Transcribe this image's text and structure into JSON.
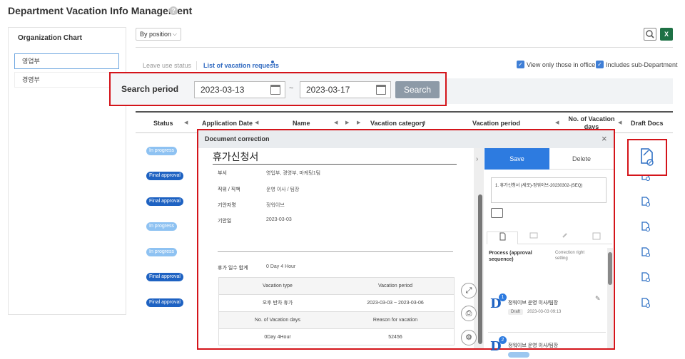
{
  "page_title": "Department Vacation Info Management",
  "help_icon": "?",
  "org_chart": {
    "title": "Organization Chart",
    "items": [
      "영업부",
      "경영부"
    ]
  },
  "toolbar": {
    "view_select": "By position",
    "excel_label": "X"
  },
  "tabs": {
    "leave_status": "Leave use status",
    "requests": "List of vacation requests"
  },
  "filters": {
    "view_office": "View only those in office",
    "include_sub": "Includes sub-Department"
  },
  "search": {
    "label": "Search period",
    "start": "2023-03-13",
    "separator": "~",
    "end": "2023-03-17",
    "button": "Search"
  },
  "table": {
    "headers": [
      "Status",
      "Application Date",
      "Name",
      "Vacation category",
      "Vacation period",
      "No. of Vacation days",
      "Draft Docs"
    ],
    "rows": [
      {
        "status": "In progress",
        "kind": "in-progress"
      },
      {
        "status": "Final approval",
        "kind": "final"
      },
      {
        "status": "Final approval",
        "kind": "final"
      },
      {
        "status": "In progress",
        "kind": "in-progress"
      },
      {
        "status": "In progress",
        "kind": "in-progress"
      },
      {
        "status": "Final approval",
        "kind": "final"
      },
      {
        "status": "Final approval",
        "kind": "final"
      }
    ]
  },
  "modal": {
    "title": "Document correction",
    "close": "×",
    "doc": {
      "title": "휴가신청서",
      "fields": [
        {
          "k": "부서",
          "v": "영업부, 경영부, 마케팅1팀"
        },
        {
          "k": "직위 / 직책",
          "v": "운영 이사 / 팀장"
        },
        {
          "k": "기안자명",
          "v": "정워이브"
        },
        {
          "k": "기안일",
          "v": "2023-03-03"
        }
      ],
      "total_label": "휴가 일수 합계",
      "total_value": "0 Day 4 Hour",
      "table": {
        "h1": "Vacation type",
        "h2": "Vacation period",
        "r1c1": "오후 반차 휴가",
        "r1c2": "2023-03-03 ~ 2023-03-06",
        "h3": "No. of Vacation days",
        "h4": "Reason for vacation",
        "r2c1": "0Day  4Hour",
        "r2c2": "52456"
      }
    },
    "side": {
      "save": "Save",
      "delete": "Delete",
      "doc_ref": "1. 휴가신청서 (세로)-정워이브-20230302-(SEQ)",
      "process_title": "Process (approval sequence)",
      "correction_setting": "Correction right setting",
      "approvers": [
        {
          "num": "1",
          "name": "정워이브 운영 이사/팀장",
          "badge": "Draft",
          "time": "2023-03-03 09:13"
        },
        {
          "num": "2",
          "name": "정워이브 운영 이사/팀장"
        }
      ]
    }
  }
}
